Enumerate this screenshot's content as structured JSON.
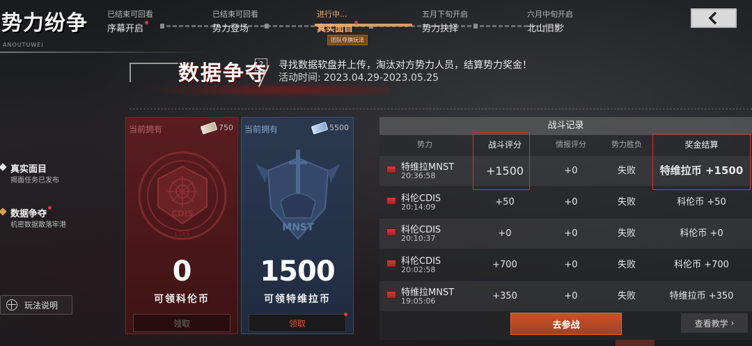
{
  "header": {
    "game_title": "势力纷争",
    "game_subtitle": "ANOUTUWEI",
    "stages": [
      {
        "status": "已结束可回看",
        "name": "序幕开启",
        "dot": true
      },
      {
        "status": "已结束可回看",
        "name": "势力登场",
        "dot": false
      },
      {
        "status": "进行中...",
        "name": "真实面目",
        "dot": true
      },
      {
        "status": "五月下旬开启",
        "name": "势力抉择",
        "dot": false
      },
      {
        "status": "六月中旬开启",
        "name": "北山旧影",
        "dot": false
      }
    ],
    "active_tag": "团队夺旗玩法",
    "back_icon": "chevron-left-icon"
  },
  "sidebar": {
    "items": [
      {
        "label": "真实面目",
        "sub": "揭面任务已发布",
        "accent": "#e8e8e8"
      },
      {
        "label": "数据争夺",
        "sub": "机密数据散落牢港",
        "accent": "#e0a040"
      }
    ],
    "how_to_play": "玩法说明"
  },
  "event": {
    "title": "数据争夺",
    "help": "?",
    "description": "寻找数据软盘并上传，淘汰对方势力人员，结算势力奖金！",
    "period_label": "活动时间:",
    "period": "2023.04.29-2023.05.25"
  },
  "cards": [
    {
      "own_label": "当前拥有",
      "balance": "750",
      "amount": "0",
      "claimable": "可领科伦币",
      "claim": "领取",
      "theme": "red",
      "emblem_text": "CDIS",
      "emblem_ring": "DEFENCE INTELLIGENCE SERVICE"
    },
    {
      "own_label": "当前拥有",
      "balance": "5500",
      "amount": "1500",
      "claimable": "可领特维拉币",
      "claim": "领取",
      "theme": "blue",
      "emblem_text": "MNST"
    }
  ],
  "record": {
    "title": "战斗记录",
    "columns": [
      "势力",
      "战斗评分",
      "情报评分",
      "势力胜负",
      "奖金结算"
    ],
    "rows": [
      {
        "faction": "特维拉MNST",
        "time": "20:36:58",
        "score": "+1500",
        "intel": "+0",
        "result": "失败",
        "reward": "特维拉币 +1500"
      },
      {
        "faction": "科伦CDIS",
        "time": "20:14:09",
        "score": "+50",
        "intel": "+0",
        "result": "失败",
        "reward": "科伦币 +50"
      },
      {
        "faction": "科伦CDIS",
        "time": "20:10:37",
        "score": "+0",
        "intel": "+0",
        "result": "失败",
        "reward": "科伦币 +0"
      },
      {
        "faction": "科伦CDIS",
        "time": "20:02:58",
        "score": "+700",
        "intel": "+0",
        "result": "失败",
        "reward": "科伦币 +700"
      },
      {
        "faction": "特维拉MNST",
        "time": "19:05:06",
        "score": "+350",
        "intel": "+0",
        "result": "失败",
        "reward": "特维拉币 +350"
      }
    ]
  },
  "actions": {
    "join_battle": "去参战",
    "view_tutorial": "查看教学",
    "tutorial_arrow": "›"
  },
  "colors": {
    "accent_orange": "#e0a050",
    "alert_red": "#e8353a",
    "cdis_red": "#5a1d20",
    "mnst_blue": "#2a3950",
    "go_button": "#b44a24"
  }
}
